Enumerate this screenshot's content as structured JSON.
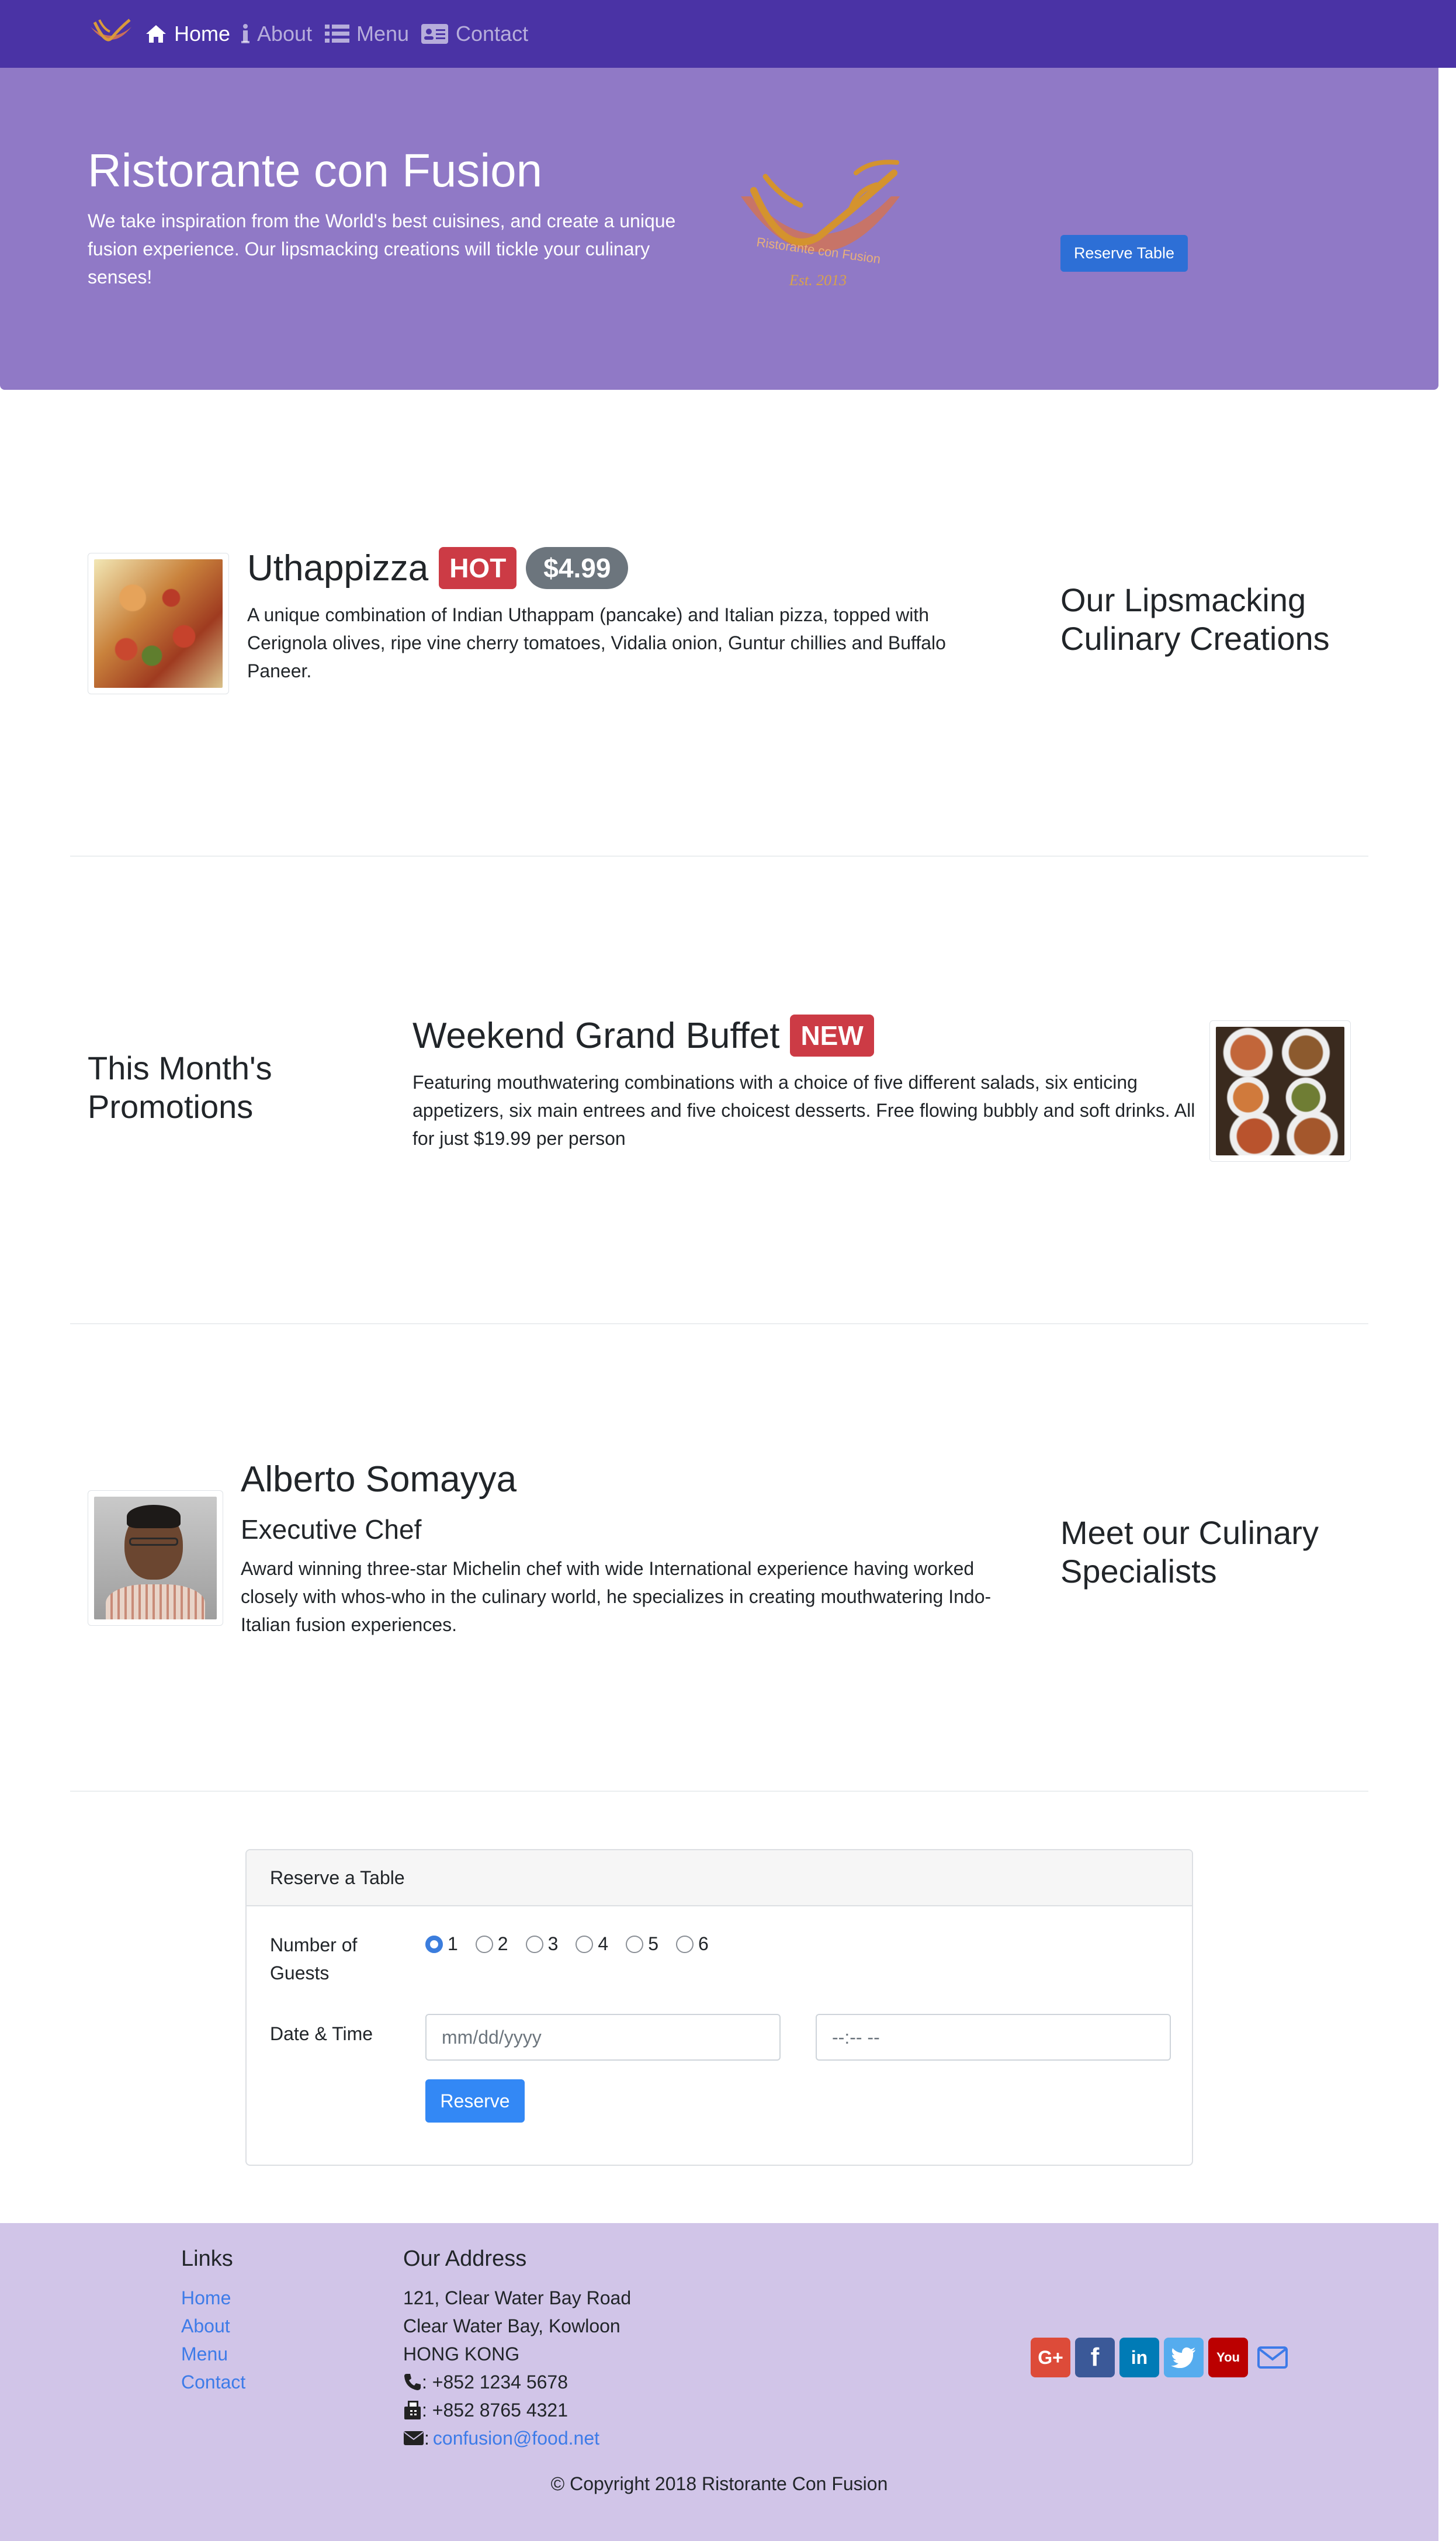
{
  "nav": {
    "items": [
      {
        "label": "Home",
        "icon": "home-icon",
        "active": true
      },
      {
        "label": "About",
        "icon": "info-icon",
        "active": false
      },
      {
        "label": "Menu",
        "icon": "list-icon",
        "active": false
      },
      {
        "label": "Contact",
        "icon": "address-card-icon",
        "active": false
      }
    ]
  },
  "jumbotron": {
    "title": "Ristorante con Fusion",
    "text": "We take inspiration from the World's best cuisines, and create a unique fusion experience. Our lipsmacking creations will tickle your culinary senses!",
    "logo_text": "Ristorante con Fusion",
    "logo_est": "Est. 2013",
    "reserve_button": "Reserve Table"
  },
  "dish": {
    "name": "Uthappizza",
    "badge": "HOT",
    "price": "$4.99",
    "description": "A unique combination of Indian Uthappam (pancake) and Italian pizza, topped with Cerignola olives, ripe vine cherry tomatoes, Vidalia onion, Guntur chillies and Buffalo Paneer.",
    "section_heading": "Our Lipsmacking Culinary Creations"
  },
  "promotion": {
    "section_heading": "This Month's Promotions",
    "name": "Weekend Grand Buffet",
    "badge": "NEW",
    "description": "Featuring mouthwatering combinations with a choice of five different salads, six enticing appetizers, six main entrees and five choicest desserts. Free flowing bubbly and soft drinks. All for just $19.99 per person"
  },
  "leader": {
    "name": "Alberto Somayya",
    "title": "Executive Chef",
    "description": "Award winning three-star Michelin chef with wide International experience having worked closely with whos-who in the culinary world, he specializes in creating mouthwatering Indo-Italian fusion experiences.",
    "section_heading": "Meet our Culinary Specialists"
  },
  "reservation": {
    "header": "Reserve a Table",
    "guests_label": "Number of Guests",
    "guest_options": [
      "1",
      "2",
      "3",
      "4",
      "5",
      "6"
    ],
    "selected_guests": "1",
    "datetime_label": "Date & Time",
    "date_placeholder": "mm/dd/yyyy",
    "time_placeholder": "--:-- --",
    "submit": "Reserve"
  },
  "footer": {
    "links_heading": "Links",
    "links": [
      "Home",
      "About",
      "Menu",
      "Contact"
    ],
    "address_heading": "Our Address",
    "address_lines": [
      "121, Clear Water Bay Road",
      "Clear Water Bay, Kowloon",
      "HONG KONG"
    ],
    "phone": ": +852 1234 5678",
    "fax": ": +852 8765 4321",
    "email": "confusion@food.net",
    "social": [
      {
        "icon": "google-plus-icon",
        "label": "G+",
        "color": "#dd4b39"
      },
      {
        "icon": "facebook-icon",
        "label": "f",
        "color": "#3b5998"
      },
      {
        "icon": "linkedin-icon",
        "label": "in",
        "color": "#007bb6"
      },
      {
        "icon": "twitter-icon",
        "label": "t",
        "color": "#55acee"
      },
      {
        "icon": "youtube-icon",
        "label": "You",
        "color": "#bb0000"
      },
      {
        "icon": "mail-icon",
        "label": "",
        "color": "#3d7be8"
      }
    ],
    "copyright": "© Copyright 2018 Ristorante Con Fusion"
  },
  "colors": {
    "navbar": "#4a33a5",
    "jumbotron": "#9079c6",
    "footer": "#d1c5e8",
    "primary": "#3388f5",
    "badge_danger": "#cc3b45",
    "badge_secondary": "#6c757d"
  }
}
